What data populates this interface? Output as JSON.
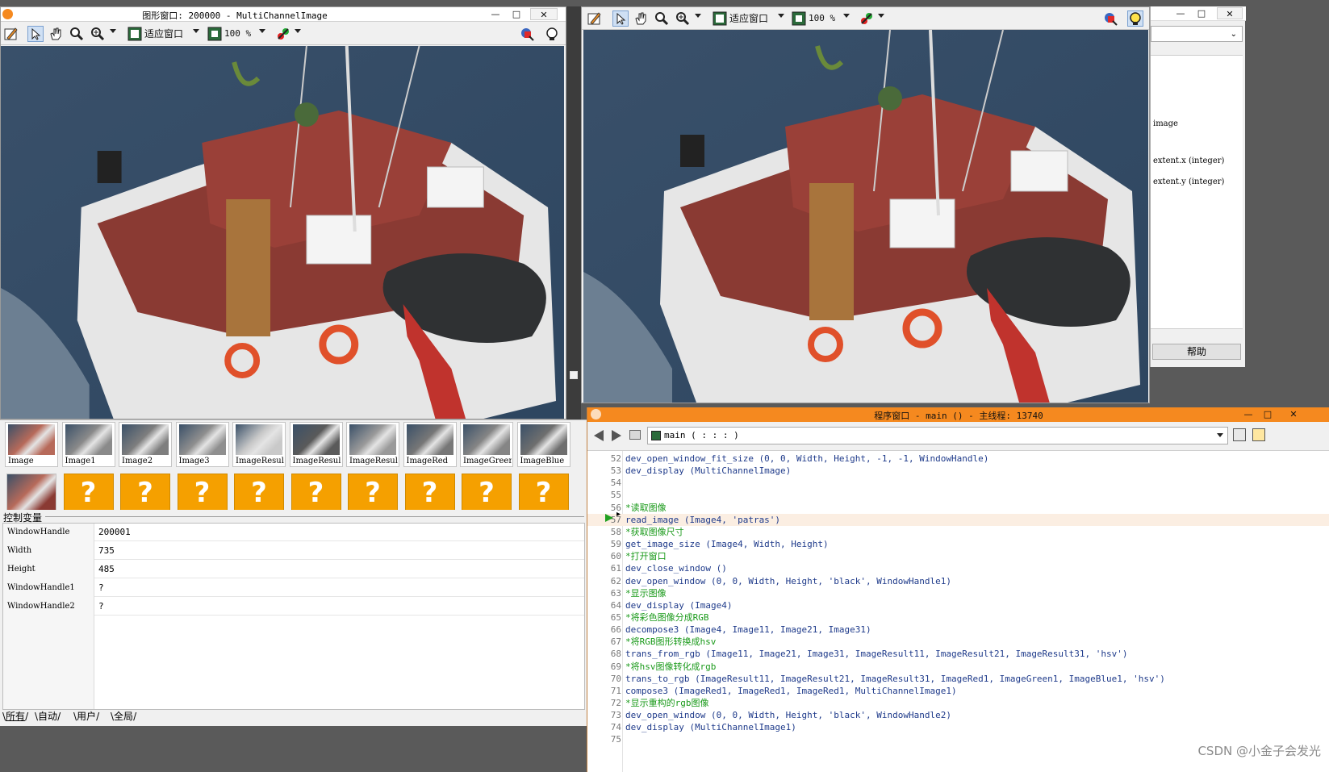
{
  "window1": {
    "title": "图形窗口: 200000 - MultiChannelImage",
    "fit_label": "适应窗口",
    "zoom_label": "100 %"
  },
  "window2": {
    "fit_label": "适应窗口",
    "zoom_label": "100 %"
  },
  "panel": {
    "lines": [
      "image",
      "extent.x (integer)",
      "extent.y (integer)"
    ],
    "help_label": "帮助"
  },
  "thumbnails": {
    "row1": [
      "Image",
      "Image1",
      "Image2",
      "Image3",
      "ImageResul",
      "ImageResul",
      "ImageResul",
      "ImageRed",
      "ImageGreer",
      "ImageBlue"
    ],
    "question_mark": "?"
  },
  "variables": {
    "header": "控制变量",
    "rows": [
      {
        "name": "WindowHandle",
        "value": "200001"
      },
      {
        "name": "Width",
        "value": "735"
      },
      {
        "name": "Height",
        "value": "485"
      },
      {
        "name": "WindowHandle1",
        "value": "?"
      },
      {
        "name": "WindowHandle2",
        "value": "?"
      }
    ],
    "tabs": [
      "所有",
      "自动",
      "用户",
      "全局"
    ]
  },
  "program": {
    "title": "程序窗口 - main () - 主线程: 13740",
    "proc_selector": "main ( : : : )",
    "lines": [
      {
        "n": "52",
        "t": "dev_open_window_fit_size (0, 0, Width, Height, -1, -1, WindowHandle)",
        "c": false
      },
      {
        "n": "53",
        "t": "dev_display (MultiChannelImage)",
        "c": false
      },
      {
        "n": "54",
        "t": "",
        "c": false
      },
      {
        "n": "55",
        "t": "",
        "c": false
      },
      {
        "n": "56",
        "t": "*读取图像",
        "c": true
      },
      {
        "n": "57",
        "t": "read_image (Image4, 'patras')",
        "c": false
      },
      {
        "n": "58",
        "t": "*获取图像尺寸",
        "c": true
      },
      {
        "n": "59",
        "t": "get_image_size (Image4, Width, Height)",
        "c": false
      },
      {
        "n": "60",
        "t": "*打开窗口",
        "c": true
      },
      {
        "n": "61",
        "t": "dev_close_window ()",
        "c": false
      },
      {
        "n": "62",
        "t": "dev_open_window (0, 0, Width, Height, 'black', WindowHandle1)",
        "c": false
      },
      {
        "n": "63",
        "t": "*显示图像",
        "c": true
      },
      {
        "n": "64",
        "t": "dev_display (Image4)",
        "c": false
      },
      {
        "n": "65",
        "t": "*将彩色图像分成RGB",
        "c": true
      },
      {
        "n": "66",
        "t": "decompose3 (Image4, Image11, Image21, Image31)",
        "c": false
      },
      {
        "n": "67",
        "t": "*将RGB图形转换成hsv",
        "c": true
      },
      {
        "n": "68",
        "t": "trans_from_rgb (Image11, Image21, Image31, ImageResult11, ImageResult21, ImageResult31, 'hsv')",
        "c": false
      },
      {
        "n": "69",
        "t": "*将hsv图像转化成rgb",
        "c": true
      },
      {
        "n": "70",
        "t": "trans_to_rgb (ImageResult11, ImageResult21, ImageResult31, ImageRed1, ImageGreen1, ImageBlue1, 'hsv')",
        "c": false
      },
      {
        "n": "71",
        "t": "compose3 (ImageRed1, ImageRed1, ImageRed1, MultiChannelImage1)",
        "c": false
      },
      {
        "n": "72",
        "t": "*显示重构的rgb图像",
        "c": true
      },
      {
        "n": "73",
        "t": "dev_open_window (0, 0, Width, Height, 'black', WindowHandle2)",
        "c": false
      },
      {
        "n": "74",
        "t": "dev_display (MultiChannelImage1)",
        "c": false
      },
      {
        "n": "75",
        "t": "",
        "c": false
      }
    ],
    "current_line": "57"
  },
  "watermark": "CSDN @小金子会发光",
  "colors": {
    "program_title": "#f5891f",
    "comment": "#1a9a1a",
    "code": "#1e3a8a",
    "placeholder": "#f5a000"
  }
}
